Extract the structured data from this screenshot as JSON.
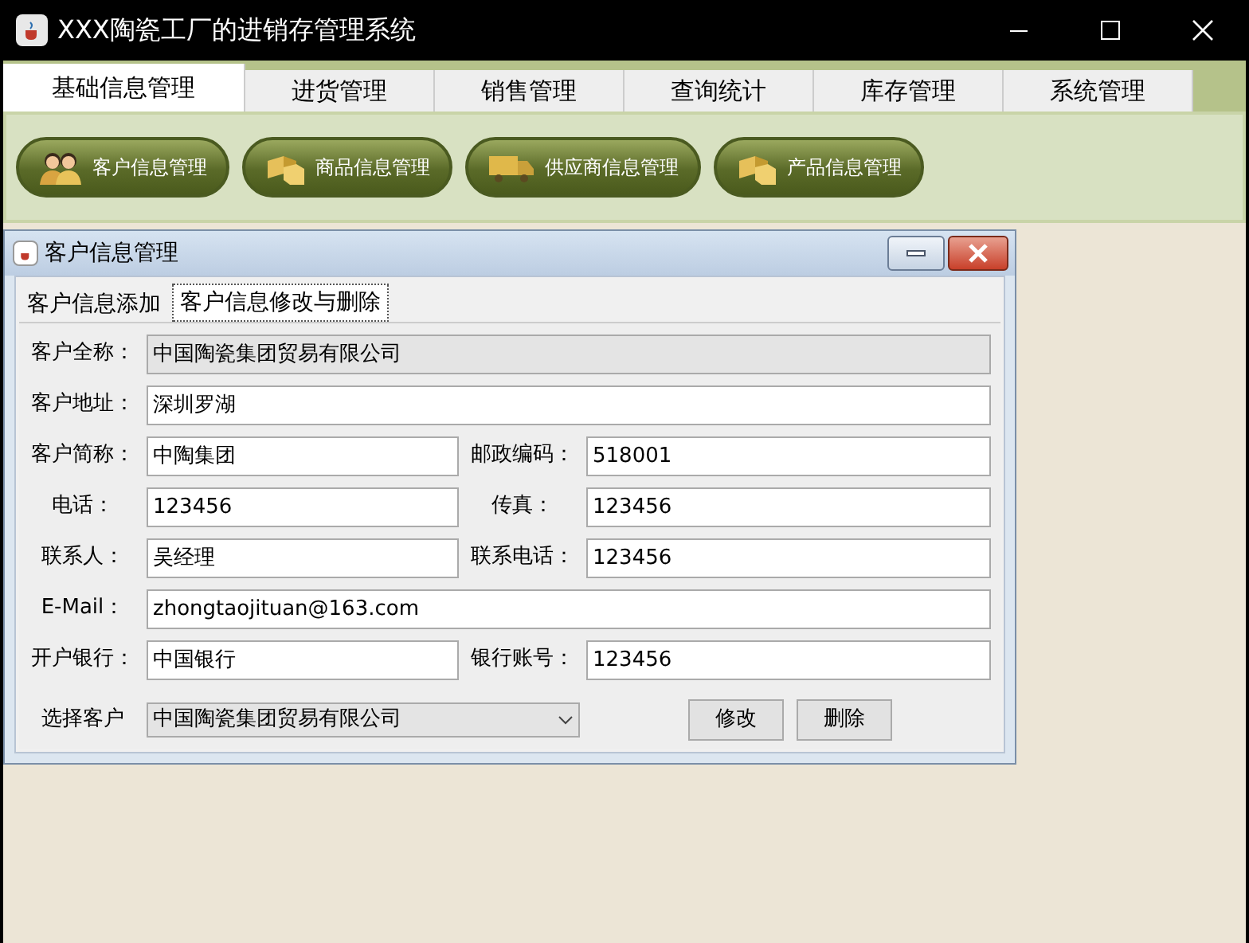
{
  "window": {
    "title": "XXX陶瓷工厂的进销存管理系统"
  },
  "menu_tabs": [
    {
      "label": "基础信息管理",
      "selected": true
    },
    {
      "label": "进货管理",
      "selected": false
    },
    {
      "label": "销售管理",
      "selected": false
    },
    {
      "label": "查询统计",
      "selected": false
    },
    {
      "label": "库存管理",
      "selected": false
    },
    {
      "label": "系统管理",
      "selected": false
    }
  ],
  "toolbar": [
    {
      "label": "客户信息管理",
      "kind": "people"
    },
    {
      "label": "商品信息管理",
      "kind": "boxes"
    },
    {
      "label": "供应商信息管理",
      "kind": "truck"
    },
    {
      "label": "产品信息管理",
      "kind": "boxes"
    }
  ],
  "dialog": {
    "title": "客户信息管理",
    "tabs": [
      {
        "label": "客户信息添加",
        "selected": false
      },
      {
        "label": "客户信息修改与删除",
        "selected": true
      }
    ],
    "rows": [
      [
        {
          "label": "客户全称：",
          "value": "中国陶瓷集团贸易有限公司",
          "disabled": true
        }
      ],
      [
        {
          "label": "客户地址：",
          "value": "深圳罗湖",
          "disabled": false
        }
      ],
      [
        {
          "label": "客户简称：",
          "value": "中陶集团",
          "disabled": false
        },
        {
          "label": "邮政编码：",
          "value": "518001",
          "disabled": false
        }
      ],
      [
        {
          "label": "电话：",
          "value": "123456",
          "disabled": false
        },
        {
          "label": "传真：",
          "value": "123456",
          "disabled": false
        }
      ],
      [
        {
          "label": "联系人：",
          "value": "吴经理",
          "disabled": false
        },
        {
          "label": "联系电话：",
          "value": "123456",
          "disabled": false
        }
      ],
      [
        {
          "label": "E-Mail：",
          "value": "zhongtaojituan@163.com",
          "disabled": false
        }
      ],
      [
        {
          "label": "开户银行：",
          "value": "中国银行",
          "disabled": false
        },
        {
          "label": "银行账号：",
          "value": "123456",
          "disabled": false
        }
      ]
    ],
    "select": {
      "label": "选择客户",
      "value": "中国陶瓷集团贸易有限公司"
    },
    "buttons": [
      "修改",
      "删除"
    ]
  }
}
